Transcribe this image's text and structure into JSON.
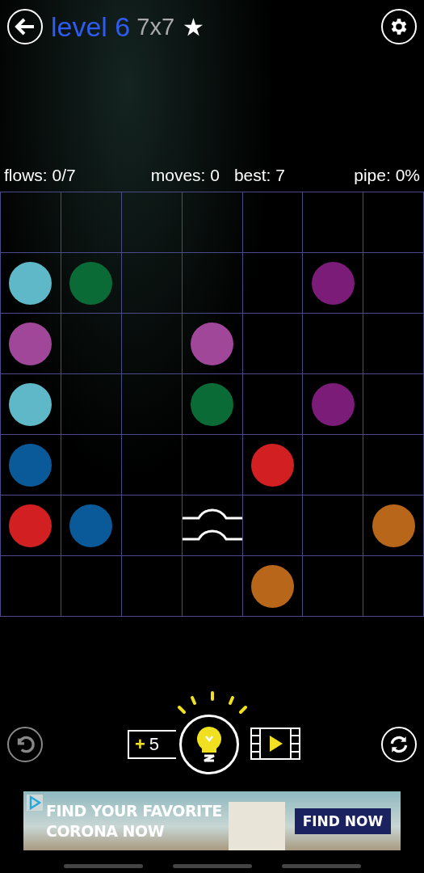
{
  "header": {
    "level_title": "level 6",
    "size": "7x7",
    "star": "★"
  },
  "stats": {
    "flows": "flows: 0/7",
    "moves": "moves: 0",
    "best": "best: 7",
    "pipe": "pipe: 0%"
  },
  "grid": {
    "rows": [
      [
        {
          "kind": "empty"
        },
        {
          "kind": "empty"
        },
        {
          "kind": "empty"
        },
        {
          "kind": "empty"
        },
        {
          "kind": "empty"
        },
        {
          "kind": "empty"
        },
        {
          "kind": "empty"
        }
      ],
      [
        {
          "kind": "dot",
          "color": "#5fb8c8"
        },
        {
          "kind": "dot",
          "color": "#0a6b37"
        },
        {
          "kind": "empty"
        },
        {
          "kind": "empty"
        },
        {
          "kind": "empty"
        },
        {
          "kind": "dot",
          "color": "#7b1c78"
        },
        {
          "kind": "empty"
        }
      ],
      [
        {
          "kind": "dot",
          "color": "#a0479a"
        },
        {
          "kind": "empty"
        },
        {
          "kind": "empty"
        },
        {
          "kind": "dot",
          "color": "#a0479a"
        },
        {
          "kind": "empty"
        },
        {
          "kind": "empty"
        },
        {
          "kind": "empty"
        }
      ],
      [
        {
          "kind": "dot",
          "color": "#5fb8c8"
        },
        {
          "kind": "empty"
        },
        {
          "kind": "empty"
        },
        {
          "kind": "dot",
          "color": "#0a6b37"
        },
        {
          "kind": "empty"
        },
        {
          "kind": "dot",
          "color": "#7b1c78"
        },
        {
          "kind": "empty"
        }
      ],
      [
        {
          "kind": "dot",
          "color": "#0a5a9a"
        },
        {
          "kind": "empty"
        },
        {
          "kind": "empty"
        },
        {
          "kind": "empty"
        },
        {
          "kind": "dot",
          "color": "#d21f22"
        },
        {
          "kind": "empty"
        },
        {
          "kind": "empty"
        }
      ],
      [
        {
          "kind": "dot",
          "color": "#d21f22"
        },
        {
          "kind": "dot",
          "color": "#0a5a9a"
        },
        {
          "kind": "empty"
        },
        {
          "kind": "bridge"
        },
        {
          "kind": "empty"
        },
        {
          "kind": "empty"
        },
        {
          "kind": "dot",
          "color": "#b8661a"
        }
      ],
      [
        {
          "kind": "empty"
        },
        {
          "kind": "empty"
        },
        {
          "kind": "empty"
        },
        {
          "kind": "empty"
        },
        {
          "kind": "dot",
          "color": "#b8661a"
        },
        {
          "kind": "empty"
        },
        {
          "kind": "empty"
        }
      ]
    ]
  },
  "controls": {
    "undo_disabled": true,
    "hint_plus": "+",
    "hint_count": "5"
  },
  "ad": {
    "headline_1": "FIND YOUR FAVORITE",
    "headline_2": "CORONA NOW",
    "button": "FIND NOW"
  }
}
